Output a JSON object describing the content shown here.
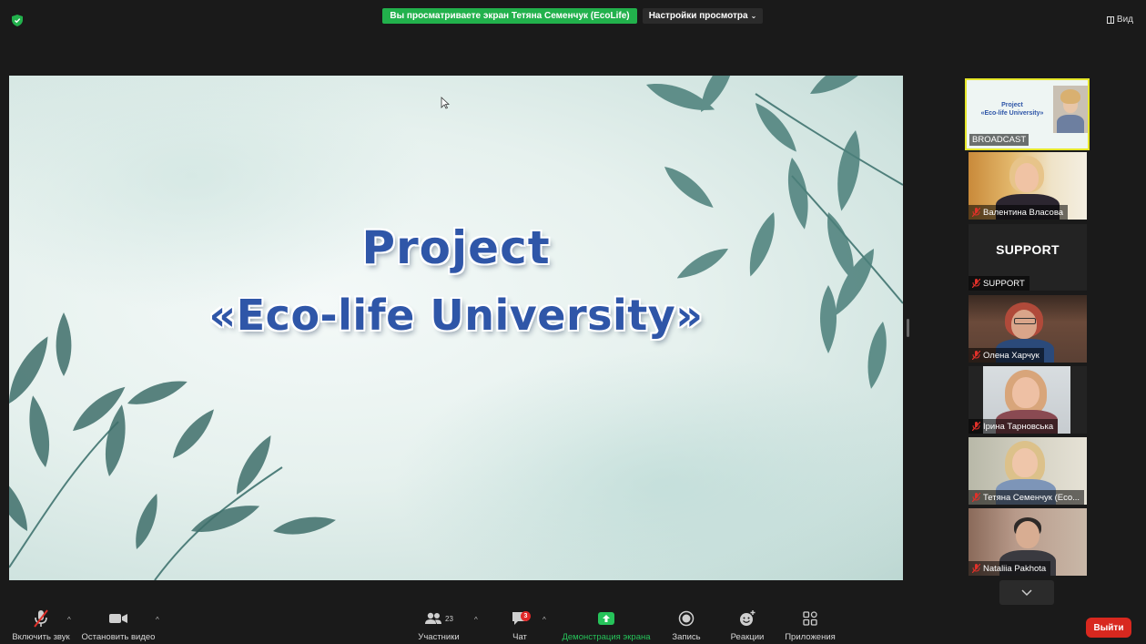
{
  "topbar": {
    "viewing_text": "Вы просматриваете экран Тетяна Семенчук (EcoLife)",
    "view_settings": "Настройки просмотра",
    "view_button": "Вид"
  },
  "slide": {
    "title_line1": "Project",
    "title_line2": "«Eco-life University»"
  },
  "thumbnail": {
    "title_line1": "Project",
    "title_line2": "«Eco-life University»",
    "label": "BROADCAST"
  },
  "participants": [
    {
      "name": "Валентина Власова"
    },
    {
      "name": "SUPPORT",
      "display_text": "SUPPORT"
    },
    {
      "name": "Олена Харчук"
    },
    {
      "name": "Ірина Тарновська"
    },
    {
      "name": "Тетяна Семенчук (Eco..."
    },
    {
      "name": "Nataliia Pakhota"
    }
  ],
  "toolbar": {
    "unmute": "Включить звук",
    "stop_video": "Остановить видео",
    "participants": "Участники",
    "participants_count": "23",
    "chat": "Чат",
    "chat_badge": "3",
    "share_screen": "Демонстрация экрана",
    "record": "Запись",
    "reactions": "Реакции",
    "apps": "Приложения",
    "leave": "Выйти"
  },
  "colors": {
    "banner_green": "#22b14c",
    "share_green": "#26c35a",
    "leave_red": "#d8281f",
    "title_blue": "#2f56a8",
    "muted_red": "#e0312a"
  }
}
